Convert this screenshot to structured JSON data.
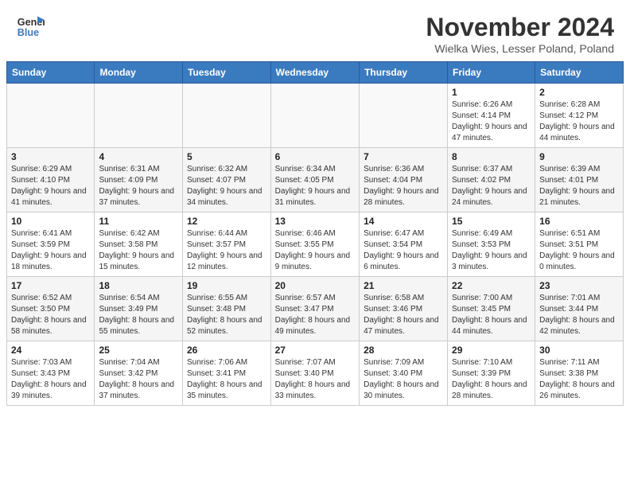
{
  "header": {
    "logo_line1": "General",
    "logo_line2": "Blue",
    "title": "November 2024",
    "subtitle": "Wielka Wies, Lesser Poland, Poland"
  },
  "days_of_week": [
    "Sunday",
    "Monday",
    "Tuesday",
    "Wednesday",
    "Thursday",
    "Friday",
    "Saturday"
  ],
  "weeks": [
    [
      {
        "day": "",
        "info": ""
      },
      {
        "day": "",
        "info": ""
      },
      {
        "day": "",
        "info": ""
      },
      {
        "day": "",
        "info": ""
      },
      {
        "day": "",
        "info": ""
      },
      {
        "day": "1",
        "info": "Sunrise: 6:26 AM\nSunset: 4:14 PM\nDaylight: 9 hours and 47 minutes."
      },
      {
        "day": "2",
        "info": "Sunrise: 6:28 AM\nSunset: 4:12 PM\nDaylight: 9 hours and 44 minutes."
      }
    ],
    [
      {
        "day": "3",
        "info": "Sunrise: 6:29 AM\nSunset: 4:10 PM\nDaylight: 9 hours and 41 minutes."
      },
      {
        "day": "4",
        "info": "Sunrise: 6:31 AM\nSunset: 4:09 PM\nDaylight: 9 hours and 37 minutes."
      },
      {
        "day": "5",
        "info": "Sunrise: 6:32 AM\nSunset: 4:07 PM\nDaylight: 9 hours and 34 minutes."
      },
      {
        "day": "6",
        "info": "Sunrise: 6:34 AM\nSunset: 4:05 PM\nDaylight: 9 hours and 31 minutes."
      },
      {
        "day": "7",
        "info": "Sunrise: 6:36 AM\nSunset: 4:04 PM\nDaylight: 9 hours and 28 minutes."
      },
      {
        "day": "8",
        "info": "Sunrise: 6:37 AM\nSunset: 4:02 PM\nDaylight: 9 hours and 24 minutes."
      },
      {
        "day": "9",
        "info": "Sunrise: 6:39 AM\nSunset: 4:01 PM\nDaylight: 9 hours and 21 minutes."
      }
    ],
    [
      {
        "day": "10",
        "info": "Sunrise: 6:41 AM\nSunset: 3:59 PM\nDaylight: 9 hours and 18 minutes."
      },
      {
        "day": "11",
        "info": "Sunrise: 6:42 AM\nSunset: 3:58 PM\nDaylight: 9 hours and 15 minutes."
      },
      {
        "day": "12",
        "info": "Sunrise: 6:44 AM\nSunset: 3:57 PM\nDaylight: 9 hours and 12 minutes."
      },
      {
        "day": "13",
        "info": "Sunrise: 6:46 AM\nSunset: 3:55 PM\nDaylight: 9 hours and 9 minutes."
      },
      {
        "day": "14",
        "info": "Sunrise: 6:47 AM\nSunset: 3:54 PM\nDaylight: 9 hours and 6 minutes."
      },
      {
        "day": "15",
        "info": "Sunrise: 6:49 AM\nSunset: 3:53 PM\nDaylight: 9 hours and 3 minutes."
      },
      {
        "day": "16",
        "info": "Sunrise: 6:51 AM\nSunset: 3:51 PM\nDaylight: 9 hours and 0 minutes."
      }
    ],
    [
      {
        "day": "17",
        "info": "Sunrise: 6:52 AM\nSunset: 3:50 PM\nDaylight: 8 hours and 58 minutes."
      },
      {
        "day": "18",
        "info": "Sunrise: 6:54 AM\nSunset: 3:49 PM\nDaylight: 8 hours and 55 minutes."
      },
      {
        "day": "19",
        "info": "Sunrise: 6:55 AM\nSunset: 3:48 PM\nDaylight: 8 hours and 52 minutes."
      },
      {
        "day": "20",
        "info": "Sunrise: 6:57 AM\nSunset: 3:47 PM\nDaylight: 8 hours and 49 minutes."
      },
      {
        "day": "21",
        "info": "Sunrise: 6:58 AM\nSunset: 3:46 PM\nDaylight: 8 hours and 47 minutes."
      },
      {
        "day": "22",
        "info": "Sunrise: 7:00 AM\nSunset: 3:45 PM\nDaylight: 8 hours and 44 minutes."
      },
      {
        "day": "23",
        "info": "Sunrise: 7:01 AM\nSunset: 3:44 PM\nDaylight: 8 hours and 42 minutes."
      }
    ],
    [
      {
        "day": "24",
        "info": "Sunrise: 7:03 AM\nSunset: 3:43 PM\nDaylight: 8 hours and 39 minutes."
      },
      {
        "day": "25",
        "info": "Sunrise: 7:04 AM\nSunset: 3:42 PM\nDaylight: 8 hours and 37 minutes."
      },
      {
        "day": "26",
        "info": "Sunrise: 7:06 AM\nSunset: 3:41 PM\nDaylight: 8 hours and 35 minutes."
      },
      {
        "day": "27",
        "info": "Sunrise: 7:07 AM\nSunset: 3:40 PM\nDaylight: 8 hours and 33 minutes."
      },
      {
        "day": "28",
        "info": "Sunrise: 7:09 AM\nSunset: 3:40 PM\nDaylight: 8 hours and 30 minutes."
      },
      {
        "day": "29",
        "info": "Sunrise: 7:10 AM\nSunset: 3:39 PM\nDaylight: 8 hours and 28 minutes."
      },
      {
        "day": "30",
        "info": "Sunrise: 7:11 AM\nSunset: 3:38 PM\nDaylight: 8 hours and 26 minutes."
      }
    ]
  ]
}
